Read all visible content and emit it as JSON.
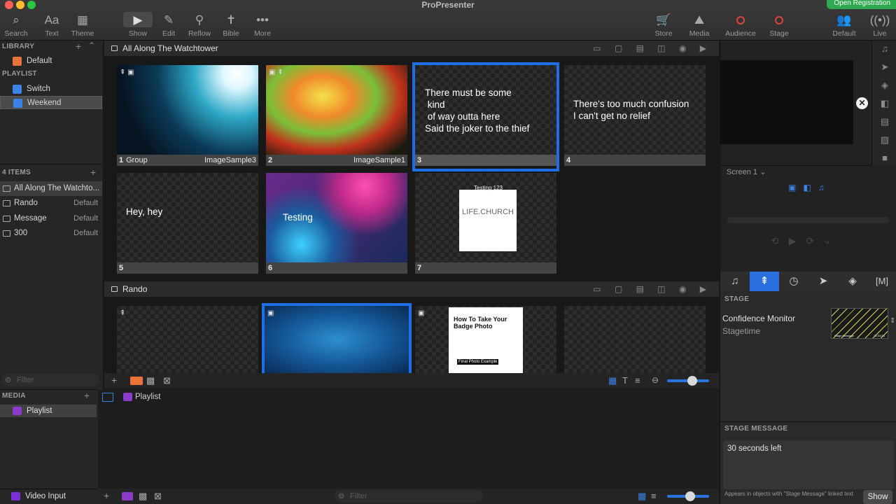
{
  "app": {
    "title": "ProPresenter",
    "registration_label": "Open Registration"
  },
  "toolbar": {
    "search": "Search",
    "text": "Text",
    "theme": "Theme",
    "show": "Show",
    "edit": "Edit",
    "reflow": "Reflow",
    "bible": "Bible",
    "more": "More",
    "store": "Store",
    "media": "Media",
    "audience": "Audience",
    "stage": "Stage",
    "default": "Default",
    "live": "Live"
  },
  "library": {
    "header": "LIBRARY",
    "items": [
      {
        "label": "Default"
      }
    ],
    "playlist_header": "PLAYLIST",
    "playlists": [
      {
        "label": "Switch"
      },
      {
        "label": "Weekend"
      }
    ]
  },
  "items_panel": {
    "header": "4 ITEMS",
    "items": [
      {
        "label": "All Along The Watchto...",
        "meta": ""
      },
      {
        "label": "Rando",
        "meta": "Default"
      },
      {
        "label": "Message",
        "meta": "Default"
      },
      {
        "label": "300",
        "meta": "Default"
      }
    ],
    "filter_placeholder": "Filter"
  },
  "media_panel": {
    "header": "MEDIA",
    "items": [
      {
        "label": "Playlist"
      }
    ],
    "video_input": "Video Input"
  },
  "presentations": [
    {
      "title": "All Along The Watchtower",
      "slides": [
        {
          "num": "1",
          "group": "Group",
          "caption": "ImageSample3",
          "text": ""
        },
        {
          "num": "2",
          "group": "",
          "caption": "ImageSample1",
          "text": ""
        },
        {
          "num": "3",
          "group": "",
          "caption": "",
          "text": "There must be some\n kind\n of way outta here\nSaid the joker to the thief"
        },
        {
          "num": "4",
          "group": "",
          "caption": "",
          "text": "There's too much confusion\nI can't get no relief"
        },
        {
          "num": "5",
          "group": "",
          "caption": "",
          "text": "Hey, hey"
        },
        {
          "num": "6",
          "group": "",
          "caption": "",
          "text": "Testing"
        },
        {
          "num": "7",
          "group": "",
          "caption": "",
          "text": "Testing 123",
          "logo": "LIFE.CHURCH"
        }
      ]
    },
    {
      "title": "Rando",
      "slides": [
        {
          "num": "",
          "text": ""
        },
        {
          "num": "",
          "text": ""
        },
        {
          "num": "",
          "text": "How To Take Your Badge Photo",
          "subtext": "Final Photo Example"
        },
        {
          "num": "",
          "text": ""
        }
      ]
    }
  ],
  "media_strip": {
    "breadcrumb": "Playlist",
    "filter_placeholder": "Filter"
  },
  "right_panel": {
    "screen_label": "Screen 1",
    "stage_header": "STAGE",
    "stage_layout": {
      "name": "Confidence Monitor",
      "sub": "Stagetime",
      "thumb_label": "Stage Message",
      "thumb_time": "12:34:56"
    },
    "stage_message_header": "STAGE MESSAGE",
    "stage_message": "30 seconds left",
    "stage_message_help": "Appears in objects with \"Stage Message\" linked text",
    "show_button": "Show"
  },
  "colors": {
    "accent": "#1e6fe6",
    "audience_red": "#e0433b",
    "registration_green": "#2da94f"
  }
}
